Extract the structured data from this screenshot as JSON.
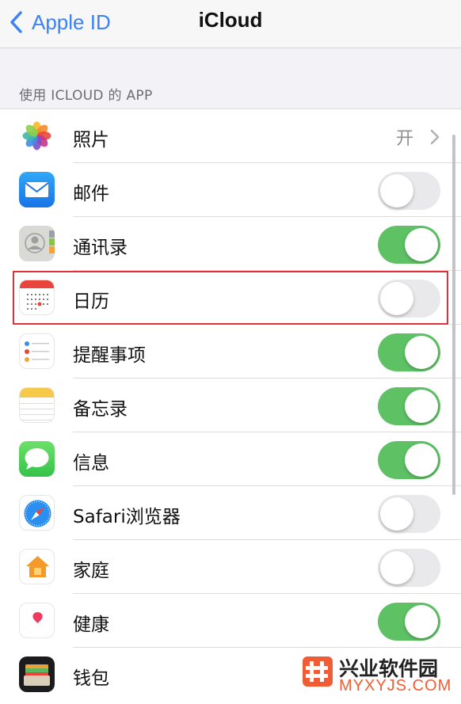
{
  "nav": {
    "back_label": "Apple ID",
    "title": "iCloud"
  },
  "section_header": "使用 ICLOUD 的 APP",
  "rows": [
    {
      "label": "照片",
      "icon": "photos-icon",
      "value": "开"
    },
    {
      "label": "邮件",
      "icon": "mail-icon",
      "toggle": false
    },
    {
      "label": "通讯录",
      "icon": "contacts-icon",
      "toggle": true
    },
    {
      "label": "日历",
      "icon": "calendar-icon",
      "toggle": false,
      "highlighted": true
    },
    {
      "label": "提醒事项",
      "icon": "reminders-icon",
      "toggle": true
    },
    {
      "label": "备忘录",
      "icon": "notes-icon",
      "toggle": true
    },
    {
      "label": "信息",
      "icon": "messages-icon",
      "toggle": true
    },
    {
      "label": "Safari浏览器",
      "icon": "safari-icon",
      "toggle": false
    },
    {
      "label": "家庭",
      "icon": "home-icon",
      "toggle": false
    },
    {
      "label": "健康",
      "icon": "health-icon",
      "toggle": true
    },
    {
      "label": "钱包",
      "icon": "wallet-icon"
    }
  ],
  "watermark": {
    "name": "兴业软件园",
    "domain": "MYXYJS.COM"
  },
  "colors": {
    "accent_blue": "#3b82f6",
    "toggle_on": "#5ec265",
    "toggle_off": "#e9e9eb",
    "highlight_red": "#e0313b"
  }
}
